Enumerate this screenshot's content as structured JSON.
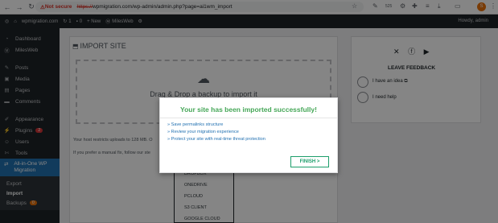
{
  "browser": {
    "security_label": "Not secure",
    "url_scheme": "https://",
    "url_rest": "wpmigration.com/wp-admin/admin.php?page=ai1wm_import",
    "avatar_letter": "S"
  },
  "adminbar": {
    "site": "wpmigration.com",
    "updates": "1",
    "comments": "0",
    "new": "+ New",
    "host": "MilesWeb",
    "howdy": "Howdy, admin"
  },
  "sidebar": {
    "items": [
      {
        "label": "Dashboard",
        "icon": "dashboard-icon"
      },
      {
        "label": "MilesWeb",
        "icon": "milesweb-icon"
      },
      {
        "label": "Posts",
        "icon": "pin-icon"
      },
      {
        "label": "Media",
        "icon": "media-icon"
      },
      {
        "label": "Pages",
        "icon": "page-icon"
      },
      {
        "label": "Comments",
        "icon": "comment-icon"
      },
      {
        "label": "Appearance",
        "icon": "brush-icon"
      },
      {
        "label": "Plugins",
        "icon": "plugin-icon",
        "badge": "2"
      },
      {
        "label": "Users",
        "icon": "user-icon"
      },
      {
        "label": "Tools",
        "icon": "wrench-icon"
      },
      {
        "label": "All-in-One WP Migration",
        "icon": "migration-icon"
      }
    ],
    "submenu": [
      "Export",
      "Import",
      "Backups"
    ],
    "backups_badge": "0"
  },
  "main": {
    "title": "IMPORT SITE",
    "drop_text": "Drag & Drop a backup to import it",
    "upload_note": "Your host restricts uploads to 128 MB. O",
    "manual_note": "If you prefer a manual fix, follow our ste",
    "dropdown_items": [
      "DROPBOX",
      "ONEDRIVE",
      "PCLOUD",
      "S3 CLIENT",
      "GOOGLE CLOUD"
    ]
  },
  "feedback": {
    "title": "LEAVE FEEDBACK",
    "option_idea": "I have an idea",
    "option_help": "I need help"
  },
  "modal": {
    "title": "Your site has been imported successfully!",
    "links": [
      "» Save permalinks structure",
      "» Review your migration experience",
      "» Protect your site with real-time threat protection"
    ],
    "finish_label": "FINISH >"
  },
  "colors": {
    "success": "#46a758",
    "link": "#2271b1",
    "finish": "#1d9e6b"
  }
}
